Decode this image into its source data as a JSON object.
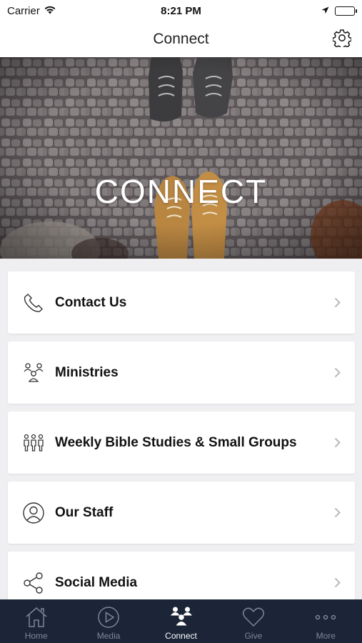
{
  "status_bar": {
    "carrier": "Carrier",
    "time": "8:21 PM"
  },
  "nav": {
    "title": "Connect",
    "settings_icon": "gear-icon"
  },
  "hero": {
    "title": "CONNECT"
  },
  "menu": {
    "items": [
      {
        "label": "Contact Us",
        "icon": "phone-icon"
      },
      {
        "label": "Ministries",
        "icon": "ministries-icon"
      },
      {
        "label": "Weekly Bible Studies & Small Groups",
        "icon": "group-icon"
      },
      {
        "label": "Our Staff",
        "icon": "person-icon"
      },
      {
        "label": "Social Media",
        "icon": "share-icon"
      }
    ]
  },
  "tab_bar": {
    "active": "Connect",
    "tabs": [
      {
        "label": "Home",
        "icon": "home-icon"
      },
      {
        "label": "Media",
        "icon": "play-icon"
      },
      {
        "label": "Connect",
        "icon": "connect-icon"
      },
      {
        "label": "Give",
        "icon": "heart-icon"
      },
      {
        "label": "More",
        "icon": "more-icon"
      }
    ]
  },
  "colors": {
    "tab_bar_bg": "#1b2537",
    "tab_inactive": "#7f8796",
    "tab_active": "#ffffff",
    "list_bg": "#efeff1"
  }
}
